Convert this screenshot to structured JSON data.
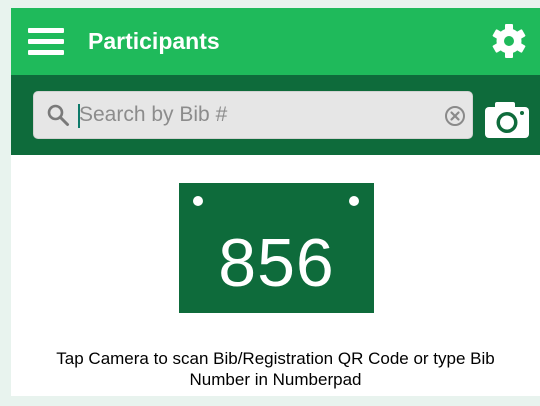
{
  "header": {
    "title": "Participants",
    "menu_icon": "hamburger-menu-icon",
    "settings_icon": "gear-icon",
    "color": "#1fba5b"
  },
  "search": {
    "placeholder": "Search by Bib #",
    "value": "",
    "search_icon": "search-icon",
    "clear_icon": "clear-icon",
    "camera_icon": "camera-icon",
    "bar_color": "#0e6b3b"
  },
  "bib": {
    "number": "856",
    "color": "#0e6b3b"
  },
  "instruction": {
    "line1": "Tap Camera to scan Bib/Registration QR Code or type Bib",
    "line2": "Number in Numberpad"
  }
}
